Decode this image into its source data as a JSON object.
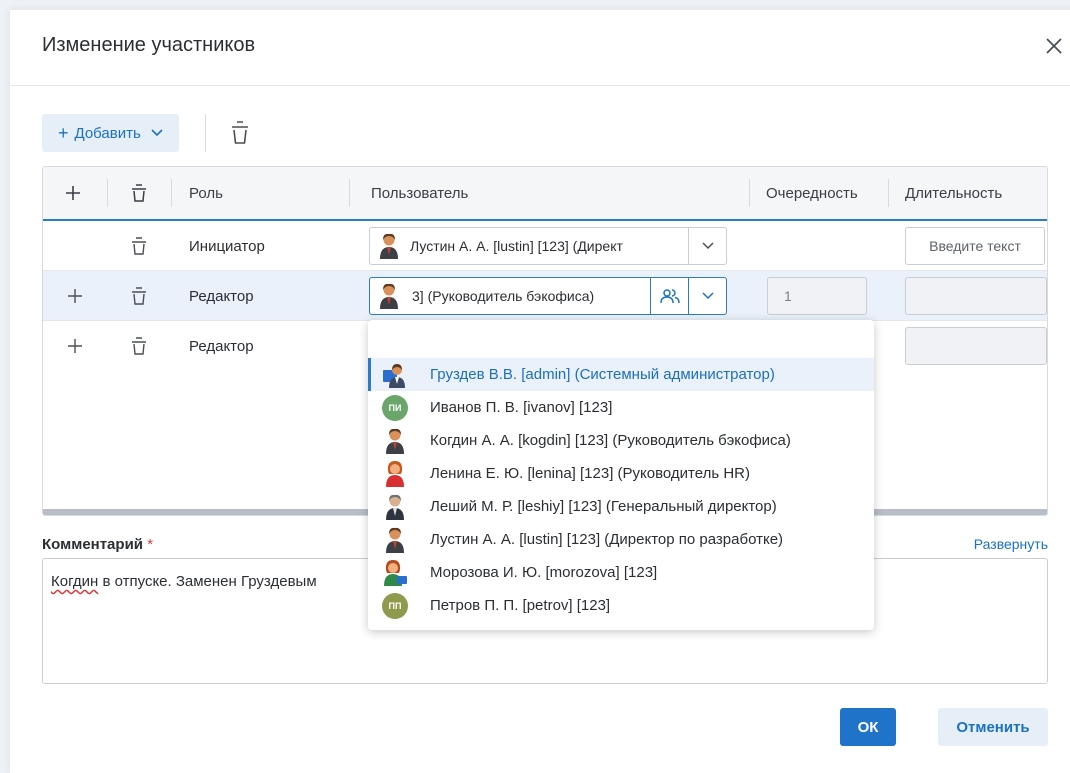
{
  "dialog": {
    "title": "Изменение участников"
  },
  "toolbar": {
    "add_label": "Добавить"
  },
  "table": {
    "headers": {
      "role": "Роль",
      "user": "Пользователь",
      "order": "Очередность",
      "duration": "Длительность"
    },
    "rows": [
      {
        "role": "Инициатор",
        "user": "Лустин А. А. [lustin] [123] (Директ",
        "duration_placeholder": "Введите текст"
      },
      {
        "role": "Редактор",
        "user": "3] (Руководитель бэкофиса)",
        "order": "1"
      },
      {
        "role": "Редактор"
      }
    ]
  },
  "dropdown": {
    "items": [
      {
        "label": "Груздев В.В. [admin] (Системный администратор)",
        "avatar": "admin-avatar-icon"
      },
      {
        "label": "Иванов П. В. [ivanov] [123]",
        "initials": "ПИ"
      },
      {
        "label": "Когдин А. А. [kogdin] [123] (Руководитель бэкофиса)",
        "avatar": "male-user-avatar-icon"
      },
      {
        "label": "Ленина Е. Ю. [lenina] [123] (Руководитель HR)",
        "avatar": "female-user-avatar-icon"
      },
      {
        "label": "Леший М. Р. [leshiy] [123] (Генеральный директор)",
        "avatar": "director-avatar-icon"
      },
      {
        "label": "Лустин А. А. [lustin] [123] (Директор по разработке)",
        "avatar": "male-user-avatar-icon"
      },
      {
        "label": "Морозова И. Ю. [morozova] [123]",
        "avatar": "female-user-avatar-icon"
      },
      {
        "label": "Петров П. П. [petrov] [123]",
        "initials": "ПП"
      }
    ]
  },
  "comment": {
    "label": "Комментарий",
    "required_mark": "*",
    "expand_label": "Развернуть",
    "text_first": "Когдин",
    "text_rest": " в отпуске. Заменен Груздевым"
  },
  "buttons": {
    "ok": "ОК",
    "cancel": "Отменить"
  },
  "colors": {
    "accent": "#1f73c8",
    "accent_light": "#e6eef8",
    "required": "#d83a3a"
  }
}
